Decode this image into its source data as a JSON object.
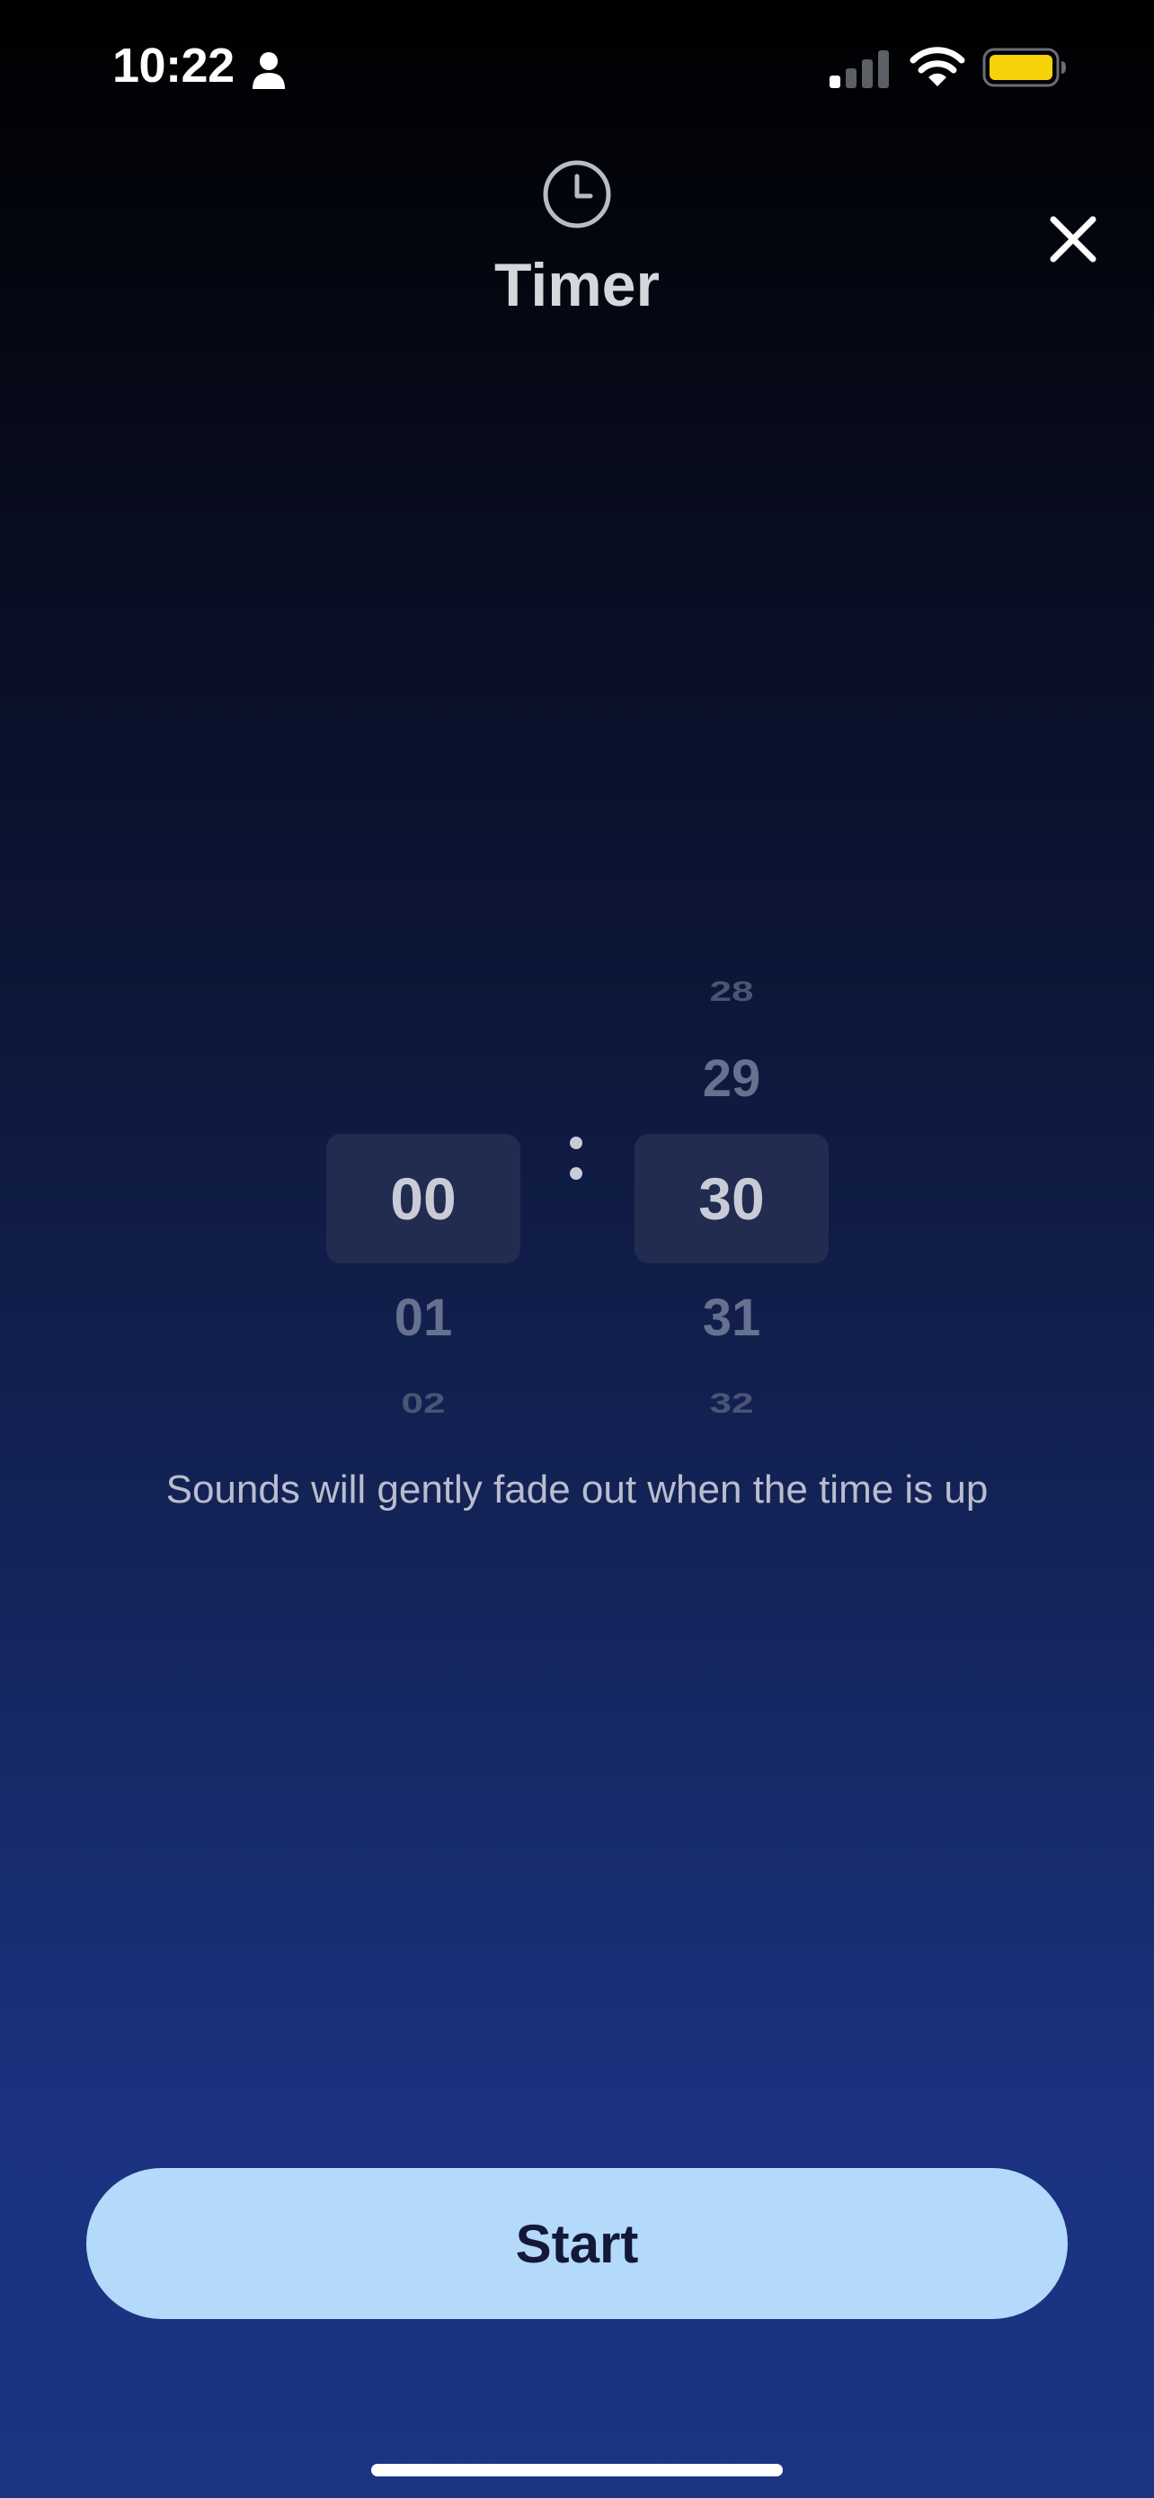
{
  "status_bar": {
    "time": "10:22",
    "icons": [
      "person-icon",
      "cellular-signal-icon",
      "wifi-icon",
      "battery-icon"
    ],
    "battery_color": "#f5d20a"
  },
  "header": {
    "icon": "clock-icon",
    "title": "Timer",
    "close_icon": "close-icon"
  },
  "picker": {
    "hours": {
      "above": [],
      "selected": "00",
      "below": [
        "01",
        "02"
      ]
    },
    "separator": ":",
    "minutes": {
      "above": [
        "28",
        "29"
      ],
      "selected": "30",
      "below": [
        "31",
        "32"
      ]
    }
  },
  "hint": "Sounds will gently fade out when the time is up",
  "actions": {
    "start_label": "Start",
    "start_color": "#b3d9fb"
  }
}
